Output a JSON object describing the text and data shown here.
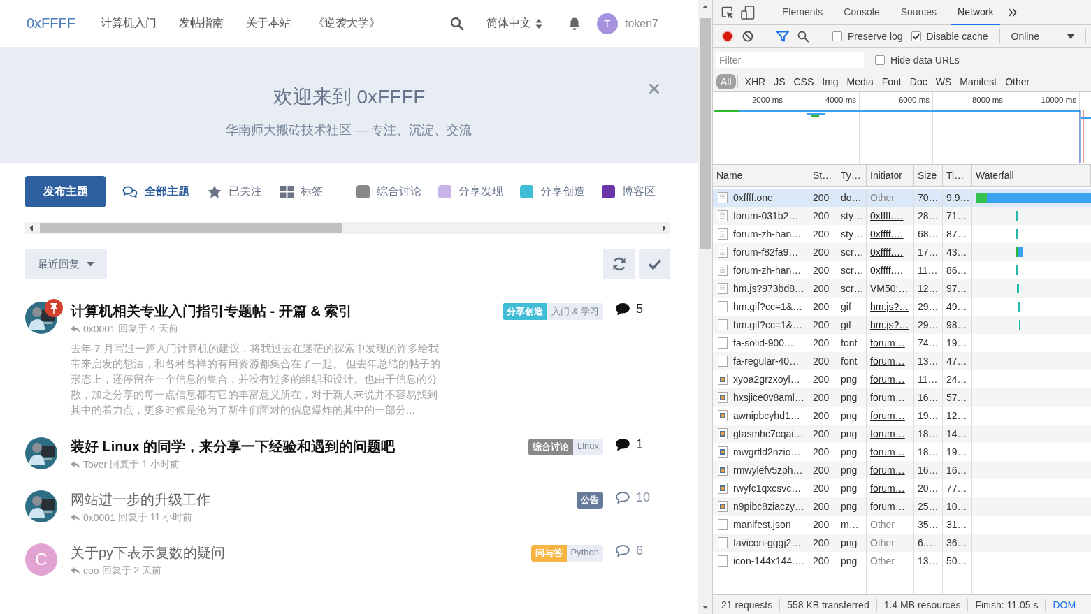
{
  "header": {
    "logo": "0xFFFF",
    "nav": [
      "计算机入门",
      "发帖指南",
      "关于本站",
      "《逆袭大学》"
    ],
    "language": "简体中文",
    "user": {
      "initial": "T",
      "name": "token7",
      "color": "#a692de"
    }
  },
  "hero": {
    "title": "欢迎来到 0xFFFF",
    "subtitle": "华南师大搬砖技术社区 — 专注、沉淀、交流"
  },
  "toolbar": {
    "start_button": "发布主题",
    "nav": [
      {
        "kind": "all",
        "label": "全部主题",
        "selected": true
      },
      {
        "kind": "following",
        "label": "已关注",
        "selected": false
      },
      {
        "kind": "tags",
        "label": "标签",
        "selected": false
      }
    ],
    "categories": [
      {
        "label": "综合讨论",
        "color": "#888888"
      },
      {
        "label": "分享发现",
        "color": "#c7b5e8"
      },
      {
        "label": "分享创造",
        "color": "#3fbdd6"
      },
      {
        "label": "博客区",
        "color": "#6a35a8"
      }
    ]
  },
  "sort": {
    "label": "最近回复"
  },
  "topics": [
    {
      "avatar": {
        "kind": "picture"
      },
      "pinned": true,
      "unread": true,
      "title": "计算机相关专业入门指引专题帖 - 开篇 & 索引",
      "user": "0x0001",
      "reply_time": "回复于 4 天前",
      "excerpt": "去年 7 月写过一篇入门计算机的建议，将我过去在迷茫的探索中发现的许多给我带来启发的想法，和各种各样的有用资源都集合在了一起。 但去年总结的帖子的形态上，还停留在一个信息的集合，并没有过多的组织和设计。也由于信息的分散，加之分享的每一点信息都有它的丰富意义所在，对于新人来说并不容易找到其中的着力点，更多时候是沦为了新生们面对的信息爆炸的其中的一部分...",
      "tags": [
        {
          "label": "分享创造",
          "color": "#3fbdd6"
        },
        {
          "label": "入门 & 学习"
        }
      ],
      "replies": "5"
    },
    {
      "avatar": {
        "kind": "picture"
      },
      "pinned": false,
      "unread": true,
      "title": "装好 Linux 的同学，来分享一下经验和遇到的问题吧",
      "user": "Tover",
      "reply_time": "回复于 1 小时前",
      "tags": [
        {
          "label": "综合讨论",
          "color": "#888888"
        },
        {
          "label": "Linux"
        }
      ],
      "replies": "1"
    },
    {
      "avatar": {
        "kind": "picture"
      },
      "pinned": false,
      "unread": false,
      "title": "网站进一步的升级工作",
      "user": "0x0001",
      "reply_time": "回复于 11 小时前",
      "tags": [
        {
          "label": "公告",
          "color": "#667b9a"
        }
      ],
      "replies": "10"
    },
    {
      "avatar": {
        "kind": "letter",
        "initial": "C",
        "color": "#e2a3d2"
      },
      "pinned": false,
      "unread": false,
      "title": "关于py下表示复数的疑问",
      "user": "coo",
      "reply_time": "回复于 2 天前",
      "tags": [
        {
          "label": "问与答",
          "color": "#f7b443"
        },
        {
          "label": "Python"
        }
      ],
      "replies": "6"
    }
  ],
  "devtools": {
    "tabs": [
      {
        "label": "Elements",
        "selected": false
      },
      {
        "label": "Console",
        "selected": false
      },
      {
        "label": "Sources",
        "selected": false
      },
      {
        "label": "Network",
        "selected": true
      }
    ],
    "preserve_log": {
      "label": "Preserve log",
      "checked": false
    },
    "disable_cache": {
      "label": "Disable cache",
      "checked": true
    },
    "throttling": "Online",
    "filter": {
      "placeholder": "Filter"
    },
    "hide_data_urls": {
      "label": "Hide data URLs",
      "checked": false
    },
    "types": [
      {
        "label": "All",
        "selected": true
      },
      {
        "label": "XHR",
        "selected": false
      },
      {
        "label": "JS",
        "selected": false
      },
      {
        "label": "CSS",
        "selected": false
      },
      {
        "label": "Img",
        "selected": false
      },
      {
        "label": "Media",
        "selected": false
      },
      {
        "label": "Font",
        "selected": false
      },
      {
        "label": "Doc",
        "selected": false
      },
      {
        "label": "WS",
        "selected": false
      },
      {
        "label": "Manifest",
        "selected": false
      },
      {
        "label": "Other",
        "selected": false
      }
    ],
    "overview_ticks": [
      "2000 ms",
      "4000 ms",
      "6000 ms",
      "8000 ms",
      "10000 ms"
    ],
    "columns": [
      "Name",
      "St…",
      "Ty…",
      "Initiator",
      "Size",
      "Ti…",
      "Waterfall"
    ],
    "requests": [
      {
        "name": "0xffff.one",
        "status": "200",
        "type": "do…",
        "initiator": "Other",
        "initiator_link": false,
        "size": "70…",
        "time": "9.9…",
        "kind": "doc",
        "selected": true
      },
      {
        "name": "forum-031b2…",
        "status": "200",
        "type": "sty…",
        "initiator": "0xffff.…",
        "initiator_link": true,
        "size": "28…",
        "time": "71…",
        "kind": "doc",
        "selected": false
      },
      {
        "name": "forum-zh-han…",
        "status": "200",
        "type": "sty…",
        "initiator": "0xffff.…",
        "initiator_link": true,
        "size": "68…",
        "time": "87…",
        "kind": "doc",
        "selected": false
      },
      {
        "name": "forum-f82fa9…",
        "status": "200",
        "type": "scr…",
        "initiator": "0xffff.…",
        "initiator_link": true,
        "size": "17…",
        "time": "43…",
        "kind": "doc",
        "selected": false
      },
      {
        "name": "forum-zh-han…",
        "status": "200",
        "type": "scr…",
        "initiator": "0xffff.…",
        "initiator_link": true,
        "size": "11…",
        "time": "86…",
        "kind": "doc",
        "selected": false
      },
      {
        "name": "hm.js?973bd8…",
        "status": "200",
        "type": "scr…",
        "initiator": "VM50:…",
        "initiator_link": true,
        "size": "12…",
        "time": "97…",
        "kind": "doc",
        "selected": false
      },
      {
        "name": "hm.gif?cc=1&…",
        "status": "200",
        "type": "gif",
        "initiator": "hm.js?…",
        "initiator_link": true,
        "size": "29…",
        "time": "49…",
        "kind": "blank",
        "selected": false
      },
      {
        "name": "hm.gif?cc=1&…",
        "status": "200",
        "type": "gif",
        "initiator": "hm.js?…",
        "initiator_link": true,
        "size": "29…",
        "time": "98…",
        "kind": "blank",
        "selected": false
      },
      {
        "name": "fa-solid-900.…",
        "status": "200",
        "type": "font",
        "initiator": "forum…",
        "initiator_link": true,
        "size": "74…",
        "time": "19…",
        "kind": "blank",
        "selected": false
      },
      {
        "name": "fa-regular-40…",
        "status": "200",
        "type": "font",
        "initiator": "forum…",
        "initiator_link": true,
        "size": "13…",
        "time": "47…",
        "kind": "blank",
        "selected": false
      },
      {
        "name": "xyoa2grzxoyl…",
        "status": "200",
        "type": "png",
        "initiator": "forum…",
        "initiator_link": true,
        "size": "11…",
        "time": "24…",
        "kind": "image",
        "selected": false
      },
      {
        "name": "hxsjice0v8aml…",
        "status": "200",
        "type": "png",
        "initiator": "forum…",
        "initiator_link": true,
        "size": "16…",
        "time": "57…",
        "kind": "image",
        "selected": false
      },
      {
        "name": "awnipbcyhd1…",
        "status": "200",
        "type": "png",
        "initiator": "forum…",
        "initiator_link": true,
        "size": "19…",
        "time": "12…",
        "kind": "image",
        "selected": false
      },
      {
        "name": "gtasmhc7cqai…",
        "status": "200",
        "type": "png",
        "initiator": "forum…",
        "initiator_link": true,
        "size": "18…",
        "time": "14…",
        "kind": "image",
        "selected": false
      },
      {
        "name": "mwgrtld2nzio…",
        "status": "200",
        "type": "png",
        "initiator": "forum…",
        "initiator_link": true,
        "size": "18…",
        "time": "19…",
        "kind": "image",
        "selected": false
      },
      {
        "name": "rmwylefv5zph…",
        "status": "200",
        "type": "png",
        "initiator": "forum…",
        "initiator_link": true,
        "size": "16…",
        "time": "16…",
        "kind": "image",
        "selected": false
      },
      {
        "name": "rwyfc1qxcsvc…",
        "status": "200",
        "type": "png",
        "initiator": "forum…",
        "initiator_link": true,
        "size": "20…",
        "time": "77…",
        "kind": "image",
        "selected": false
      },
      {
        "name": "n9pibc8ziaczy…",
        "status": "200",
        "type": "png",
        "initiator": "forum…",
        "initiator_link": true,
        "size": "25…",
        "time": "10…",
        "kind": "image",
        "selected": false
      },
      {
        "name": "manifest.json",
        "status": "200",
        "type": "m…",
        "initiator": "Other",
        "initiator_link": false,
        "size": "35…",
        "time": "31…",
        "kind": "blank",
        "selected": false
      },
      {
        "name": "favicon-gggj2…",
        "status": "200",
        "type": "png",
        "initiator": "Other",
        "initiator_link": false,
        "size": "6.…",
        "time": "36…",
        "kind": "blank",
        "selected": false
      },
      {
        "name": "icon-144x144.…",
        "status": "200",
        "type": "png",
        "initiator": "Other",
        "initiator_link": false,
        "size": "13…",
        "time": "50…",
        "kind": "blank",
        "selected": false
      }
    ],
    "status": [
      "21 requests",
      "558 KB transferred",
      "1.4 MB resources",
      "Finish: 11.05 s",
      "DOM"
    ]
  }
}
